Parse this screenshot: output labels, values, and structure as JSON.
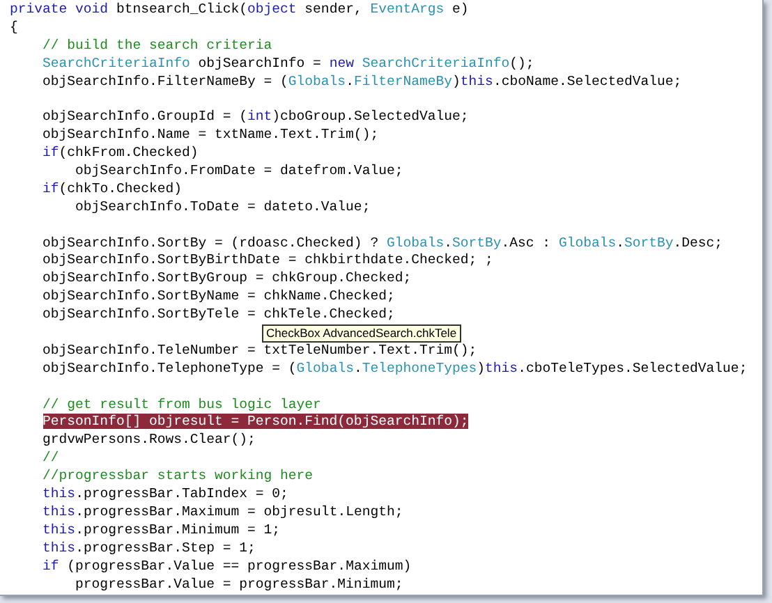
{
  "editor": {
    "lines": [
      {
        "kind": "code",
        "highlighted": false,
        "tokens": [
          {
            "kind": "keyword",
            "text": "private"
          },
          {
            "kind": "keyword",
            "text": " void"
          },
          {
            "kind": "plain",
            "text": " btnsearch_Click("
          },
          {
            "kind": "keyword",
            "text": "object"
          },
          {
            "kind": "plain",
            "text": " sender, "
          },
          {
            "kind": "type",
            "text": "EventArgs"
          },
          {
            "kind": "plain",
            "text": " e)"
          }
        ]
      },
      {
        "kind": "code",
        "highlighted": false,
        "tokens": [
          {
            "kind": "plain",
            "text": "{"
          }
        ]
      },
      {
        "kind": "code",
        "highlighted": false,
        "tokens": [
          {
            "kind": "comment",
            "text": "    // build the search criteria"
          }
        ]
      },
      {
        "kind": "code",
        "highlighted": false,
        "tokens": [
          {
            "kind": "type",
            "text": "    SearchCriteriaInfo"
          },
          {
            "kind": "plain",
            "text": " objSearchInfo = "
          },
          {
            "kind": "keyword",
            "text": "new"
          },
          {
            "kind": "type",
            "text": " SearchCriteriaInfo"
          },
          {
            "kind": "plain",
            "text": "();"
          }
        ]
      },
      {
        "kind": "code",
        "highlighted": false,
        "tokens": [
          {
            "kind": "plain",
            "text": "    objSearchInfo.FilterNameBy = ("
          },
          {
            "kind": "type",
            "text": "Globals"
          },
          {
            "kind": "plain",
            "text": "."
          },
          {
            "kind": "type",
            "text": "FilterNameBy"
          },
          {
            "kind": "plain",
            "text": ")"
          },
          {
            "kind": "keyword",
            "text": "this"
          },
          {
            "kind": "plain",
            "text": ".cboName.SelectedValue;"
          }
        ]
      },
      {
        "kind": "blank"
      },
      {
        "kind": "code",
        "highlighted": false,
        "tokens": [
          {
            "kind": "plain",
            "text": "    objSearchInfo.GroupId = ("
          },
          {
            "kind": "keyword",
            "text": "int"
          },
          {
            "kind": "plain",
            "text": ")cboGroup.SelectedValue;"
          }
        ]
      },
      {
        "kind": "code",
        "highlighted": false,
        "tokens": [
          {
            "kind": "plain",
            "text": "    objSearchInfo.Name = txtName.Text.Trim();"
          }
        ]
      },
      {
        "kind": "code",
        "highlighted": false,
        "tokens": [
          {
            "kind": "keyword",
            "text": "    if"
          },
          {
            "kind": "plain",
            "text": "(chkFrom.Checked)"
          }
        ]
      },
      {
        "kind": "code",
        "highlighted": false,
        "tokens": [
          {
            "kind": "plain",
            "text": "        objSearchInfo.FromDate = datefrom.Value;"
          }
        ]
      },
      {
        "kind": "code",
        "highlighted": false,
        "tokens": [
          {
            "kind": "keyword",
            "text": "    if"
          },
          {
            "kind": "plain",
            "text": "(chkTo.Checked)"
          }
        ]
      },
      {
        "kind": "code",
        "highlighted": false,
        "tokens": [
          {
            "kind": "plain",
            "text": "        objSearchInfo.ToDate = dateto.Value;"
          }
        ]
      },
      {
        "kind": "blank"
      },
      {
        "kind": "code",
        "highlighted": false,
        "tokens": [
          {
            "kind": "plain",
            "text": "    objSearchInfo.SortBy = (rdoasc.Checked) ? "
          },
          {
            "kind": "type",
            "text": "Globals"
          },
          {
            "kind": "plain",
            "text": "."
          },
          {
            "kind": "type",
            "text": "SortBy"
          },
          {
            "kind": "plain",
            "text": ".Asc : "
          },
          {
            "kind": "type",
            "text": "Globals"
          },
          {
            "kind": "plain",
            "text": "."
          },
          {
            "kind": "type",
            "text": "SortBy"
          },
          {
            "kind": "plain",
            "text": ".Desc;"
          }
        ]
      },
      {
        "kind": "code",
        "highlighted": false,
        "tokens": [
          {
            "kind": "plain",
            "text": "    objSearchInfo.SortByBirthDate = chkbirthdate.Checked; ;"
          }
        ]
      },
      {
        "kind": "code",
        "highlighted": false,
        "tokens": [
          {
            "kind": "plain",
            "text": "    objSearchInfo.SortByGroup = chkGroup.Checked;"
          }
        ]
      },
      {
        "kind": "code",
        "highlighted": false,
        "tokens": [
          {
            "kind": "plain",
            "text": "    objSearchInfo.SortByName = chkName.Checked;"
          }
        ]
      },
      {
        "kind": "code",
        "highlighted": false,
        "tokens": [
          {
            "kind": "plain",
            "text": "    objSearchInfo.SortByTele = chkTele.Checked;"
          }
        ]
      },
      {
        "kind": "blank"
      },
      {
        "kind": "code",
        "highlighted": false,
        "tokens": [
          {
            "kind": "plain",
            "text": "    objSearchInfo.TeleNumber = txtTeleNumber.Text.Trim();"
          }
        ]
      },
      {
        "kind": "code",
        "highlighted": false,
        "tokens": [
          {
            "kind": "plain",
            "text": "    objSearchInfo.TelephoneType = ("
          },
          {
            "kind": "type",
            "text": "Globals"
          },
          {
            "kind": "plain",
            "text": "."
          },
          {
            "kind": "type",
            "text": "TelephoneTypes"
          },
          {
            "kind": "plain",
            "text": ")"
          },
          {
            "kind": "keyword",
            "text": "this"
          },
          {
            "kind": "plain",
            "text": ".cboTeleTypes.SelectedValue;"
          }
        ]
      },
      {
        "kind": "blank"
      },
      {
        "kind": "code",
        "highlighted": false,
        "tokens": [
          {
            "kind": "comment",
            "text": "    // get result from bus logic layer"
          }
        ]
      },
      {
        "kind": "code",
        "highlighted": true,
        "tokens": [
          {
            "kind": "plain",
            "text": "    PersonInfo[] objresult = Person.Find(objSearchInfo);"
          }
        ]
      },
      {
        "kind": "code",
        "highlighted": false,
        "tokens": [
          {
            "kind": "plain",
            "text": "    grdvwPersons.Rows.Clear();"
          }
        ]
      },
      {
        "kind": "code",
        "highlighted": false,
        "tokens": [
          {
            "kind": "comment",
            "text": "    //"
          }
        ]
      },
      {
        "kind": "code",
        "highlighted": false,
        "tokens": [
          {
            "kind": "comment",
            "text": "    //progressbar starts working here"
          }
        ]
      },
      {
        "kind": "code",
        "highlighted": false,
        "tokens": [
          {
            "kind": "keyword",
            "text": "    this"
          },
          {
            "kind": "plain",
            "text": ".progressBar.TabIndex = 0;"
          }
        ]
      },
      {
        "kind": "code",
        "highlighted": false,
        "tokens": [
          {
            "kind": "keyword",
            "text": "    this"
          },
          {
            "kind": "plain",
            "text": ".progressBar.Maximum = objresult.Length;"
          }
        ]
      },
      {
        "kind": "code",
        "highlighted": false,
        "tokens": [
          {
            "kind": "keyword",
            "text": "    this"
          },
          {
            "kind": "plain",
            "text": ".progressBar.Minimum = 1;"
          }
        ]
      },
      {
        "kind": "code",
        "highlighted": false,
        "tokens": [
          {
            "kind": "keyword",
            "text": "    this"
          },
          {
            "kind": "plain",
            "text": ".progressBar.Step = 1;"
          }
        ]
      },
      {
        "kind": "code",
        "highlighted": false,
        "tokens": [
          {
            "kind": "keyword",
            "text": "    if"
          },
          {
            "kind": "plain",
            "text": " (progressBar.Value == progressBar.Maximum)"
          }
        ]
      },
      {
        "kind": "code",
        "highlighted": false,
        "tokens": [
          {
            "kind": "plain",
            "text": "        progressBar.Value = progressBar.Minimum;"
          }
        ]
      }
    ],
    "tooltip": {
      "text": "CheckBox AdvancedSearch.chkTele"
    }
  }
}
